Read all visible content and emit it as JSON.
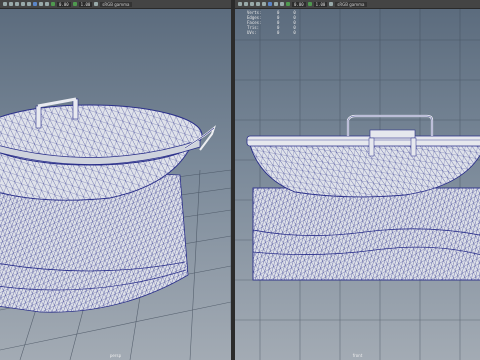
{
  "left_viewport": {
    "toolbar": {
      "field_a": "0.00",
      "field_b": "1.00",
      "panel_label": "sRGB gamma"
    },
    "camera_label": "persp"
  },
  "right_viewport": {
    "toolbar": {
      "field_a": "0.00",
      "field_b": "1.00",
      "panel_label": "sRGB gamma"
    },
    "camera_label": "front",
    "hud": [
      {
        "label": "Verts:",
        "v1": "0",
        "v2": "0"
      },
      {
        "label": "Edges:",
        "v1": "0",
        "v2": "0"
      },
      {
        "label": "Faces:",
        "v1": "0",
        "v2": "0"
      },
      {
        "label": "Tris:",
        "v1": "0",
        "v2": "0"
      },
      {
        "label": "UVs:",
        "v1": "0",
        "v2": "0"
      }
    ]
  },
  "colors": {
    "wire": "#2a2f8a",
    "mesh": "#dfe2ea",
    "grid": "#3b4655"
  }
}
